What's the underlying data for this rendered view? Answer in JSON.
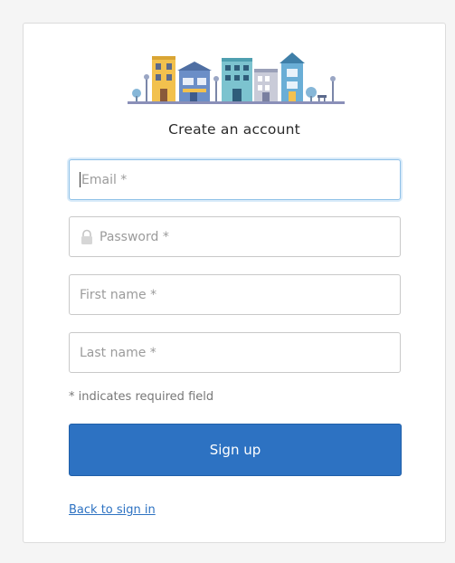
{
  "form": {
    "heading": "Create an account",
    "email_placeholder": "Email *",
    "password_placeholder": "Password *",
    "first_name_placeholder": "First name *",
    "last_name_placeholder": "Last name *",
    "required_hint": "* indicates required field",
    "signup_label": "Sign up",
    "back_link": "Back to sign in"
  },
  "icons": {
    "logo": "town-buildings-illustration",
    "password_field": "lock-icon"
  },
  "colors": {
    "primary_button": "#2d72c2",
    "link": "#2d72c2",
    "focus_border": "#8fc1e8"
  }
}
